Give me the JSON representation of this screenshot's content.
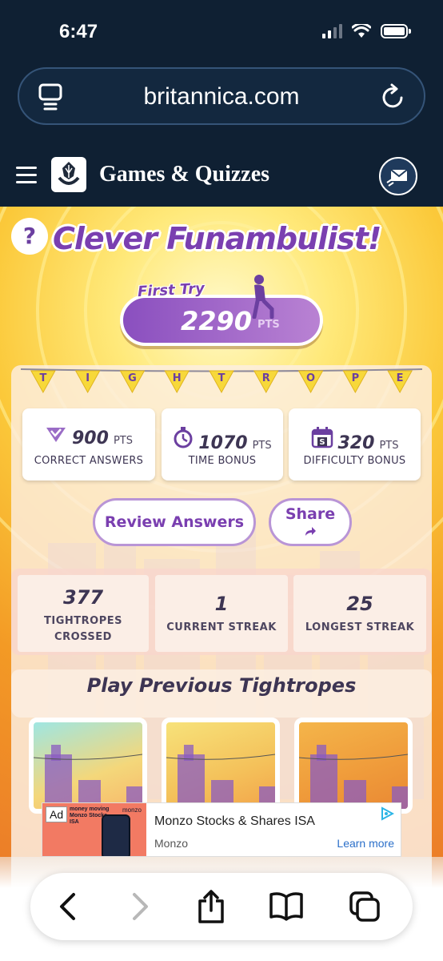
{
  "status_bar": {
    "time": "6:47"
  },
  "browser": {
    "url": "britannica.com"
  },
  "site": {
    "title": "Games & Quizzes"
  },
  "game": {
    "headline": "Clever Funambulist!",
    "first_try": "First Try",
    "score": "2290",
    "score_unit": "PTS",
    "banner_letters": [
      "T",
      "I",
      "G",
      "H",
      "T",
      "R",
      "O",
      "P",
      "E"
    ],
    "stats": [
      {
        "value": "900",
        "unit": "PTS",
        "label": "CORRECT ANSWERS",
        "icon": "check-triangle-icon"
      },
      {
        "value": "1070",
        "unit": "PTS",
        "label": "TIME BONUS",
        "icon": "stopwatch-icon"
      },
      {
        "value": "320",
        "unit": "PTS",
        "label": "DIFFICULTY BONUS",
        "icon": "calendar-s-icon"
      }
    ],
    "review_label": "Review Answers",
    "share_label": "Share",
    "streaks": [
      {
        "value": "377",
        "label_line1": "TIGHTROPES",
        "label_line2": "CROSSED"
      },
      {
        "value": "1",
        "label_line1": "CURRENT STREAK",
        "label_line2": ""
      },
      {
        "value": "25",
        "label_line1": "LONGEST STREAK",
        "label_line2": ""
      }
    ],
    "previous_title": "Play Previous Tightropes",
    "colors": {
      "purple": "#7a3fb0",
      "orange": "#f39a25",
      "yellow": "#ffe97a"
    }
  },
  "ad": {
    "badge": "Ad",
    "image_headline": "money moving Monzo Stocks ISA",
    "image_brand": "monzo",
    "title": "Monzo Stocks & Shares ISA",
    "advertiser": "Monzo",
    "cta": "Learn more"
  }
}
